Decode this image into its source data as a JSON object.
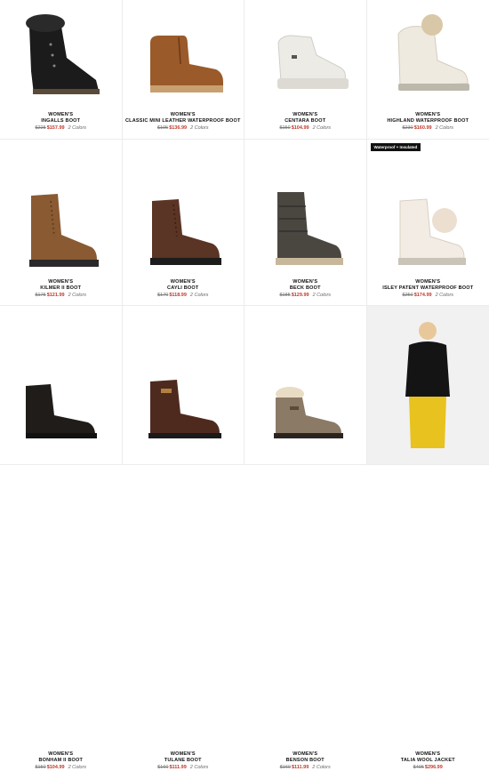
{
  "products": [
    {
      "category": "WOMEN'S",
      "name": "INGALLS BOOT",
      "old_price": "$225",
      "new_price": "$157.99",
      "colors": "2 Colors",
      "icon": "boot-icon"
    },
    {
      "category": "WOMEN'S",
      "name": "CLASSIC MINI LEATHER WATERPROOF BOOT",
      "old_price": "$195",
      "new_price": "$136.99",
      "colors": "2 Colors",
      "icon": "boot-icon"
    },
    {
      "category": "WOMEN'S",
      "name": "CENTARA BOOT",
      "old_price": "$150",
      "new_price": "$104.99",
      "colors": "2 Colors",
      "icon": "boot-icon"
    },
    {
      "category": "WOMEN'S",
      "name": "HIGHLAND WATERPROOF BOOT",
      "old_price": "$230",
      "new_price": "$160.99",
      "colors": "2 Colors",
      "icon": "boot-icon"
    },
    {
      "category": "WOMEN'S",
      "name": "KILMER II BOOT",
      "old_price": "$175",
      "new_price": "$121.99",
      "colors": "2 Colors",
      "icon": "boot-icon"
    },
    {
      "category": "WOMEN'S",
      "name": "CAYLI BOOT",
      "old_price": "$170",
      "new_price": "$118.99",
      "colors": "2 Colors",
      "icon": "boot-icon"
    },
    {
      "category": "WOMEN'S",
      "name": "BECK BOOT",
      "old_price": "$185",
      "new_price": "$129.99",
      "colors": "2 Colors",
      "icon": "boot-icon"
    },
    {
      "category": "WOMEN'S",
      "name": "ISLEY PATENT WATERPROOF BOOT",
      "old_price": "$250",
      "new_price": "$174.99",
      "colors": "2 Colors",
      "icon": "boot-icon",
      "badge": "Waterproof + Insulated"
    },
    {
      "category": "WOMEN'S",
      "name": "BONHAM II BOOT",
      "old_price": "$150",
      "new_price": "$104.99",
      "colors": "2 Colors",
      "icon": "boot-icon"
    },
    {
      "category": "WOMEN'S",
      "name": "TULANE BOOT",
      "old_price": "$160",
      "new_price": "$111.99",
      "colors": "2 Colors",
      "icon": "boot-icon"
    },
    {
      "category": "WOMEN'S",
      "name": "BENSON BOOT",
      "old_price": "$160",
      "new_price": "$111.99",
      "colors": "2 Colors",
      "icon": "boot-icon"
    },
    {
      "category": "WOMEN'S",
      "name": "TALIA WOOL JACKET",
      "old_price": "$495",
      "new_price": "$296.99",
      "icon": "jacket-icon"
    }
  ],
  "colors": {
    "sale": "#c0392b",
    "border": "#ececec"
  }
}
